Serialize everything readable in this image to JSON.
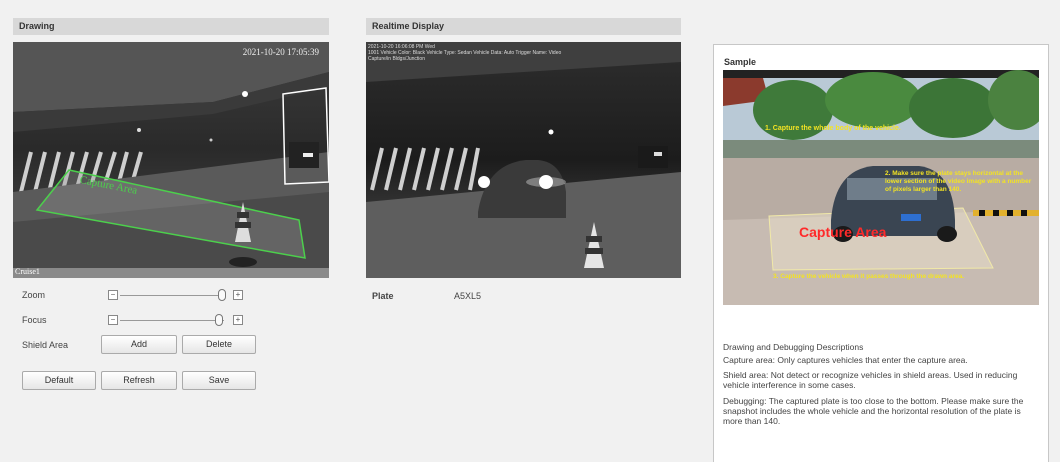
{
  "drawing": {
    "title": "Drawing",
    "timestamp": "2021-10-20 17:05:39",
    "capture_label": "Capture Area",
    "channel_label": "Cruise1"
  },
  "realtime": {
    "title": "Realtime Display",
    "overlay_line1": "2021-10-20 16:06:08 PM Wed",
    "overlay_line2": "1001 Vehicle Color: Black Vehicle Type: Sedan Vehicle Data: Auto Trigger Name: Video",
    "overlay_line3": "Capture/in Bldgs/Junction"
  },
  "controls": {
    "zoom_label": "Zoom",
    "focus_label": "Focus",
    "shield_label": "Shield Area",
    "add": "Add",
    "delete": "Delete",
    "default": "Default",
    "refresh": "Refresh",
    "save": "Save",
    "minus": "−",
    "plus": "+",
    "zoom_level": 0.96,
    "focus_level": 0.95
  },
  "plate": {
    "label": "Plate",
    "value": "A5XL5"
  },
  "sample": {
    "title": "Sample",
    "step1": "1. Capture the whole body of the vehicle.",
    "step2": "2. Make sure the plate stays horizontal at the lower section of the video image with a number of pixels larger than 140.",
    "capture_text": "Capture Area",
    "step3": "3. Capture the vehicle when it passes through the drawn area.",
    "desc_title": "Drawing and Debugging Descriptions",
    "desc_capture": "Capture area: Only captures vehicles that enter the capture area.",
    "desc_shield": "Shield area: Not detect or recognize vehicles in shield areas. Used in reducing vehicle interference in some cases.",
    "desc_debug": "Debugging: The captured plate is too close to the bottom. Please make sure the snapshot includes the whole vehicle and the horizontal resolution of the plate is more than 140."
  },
  "colors": {
    "capture_green": "#4cd04c",
    "sample_red": "#ff2a2a",
    "sample_yellow": "#f3e323"
  }
}
